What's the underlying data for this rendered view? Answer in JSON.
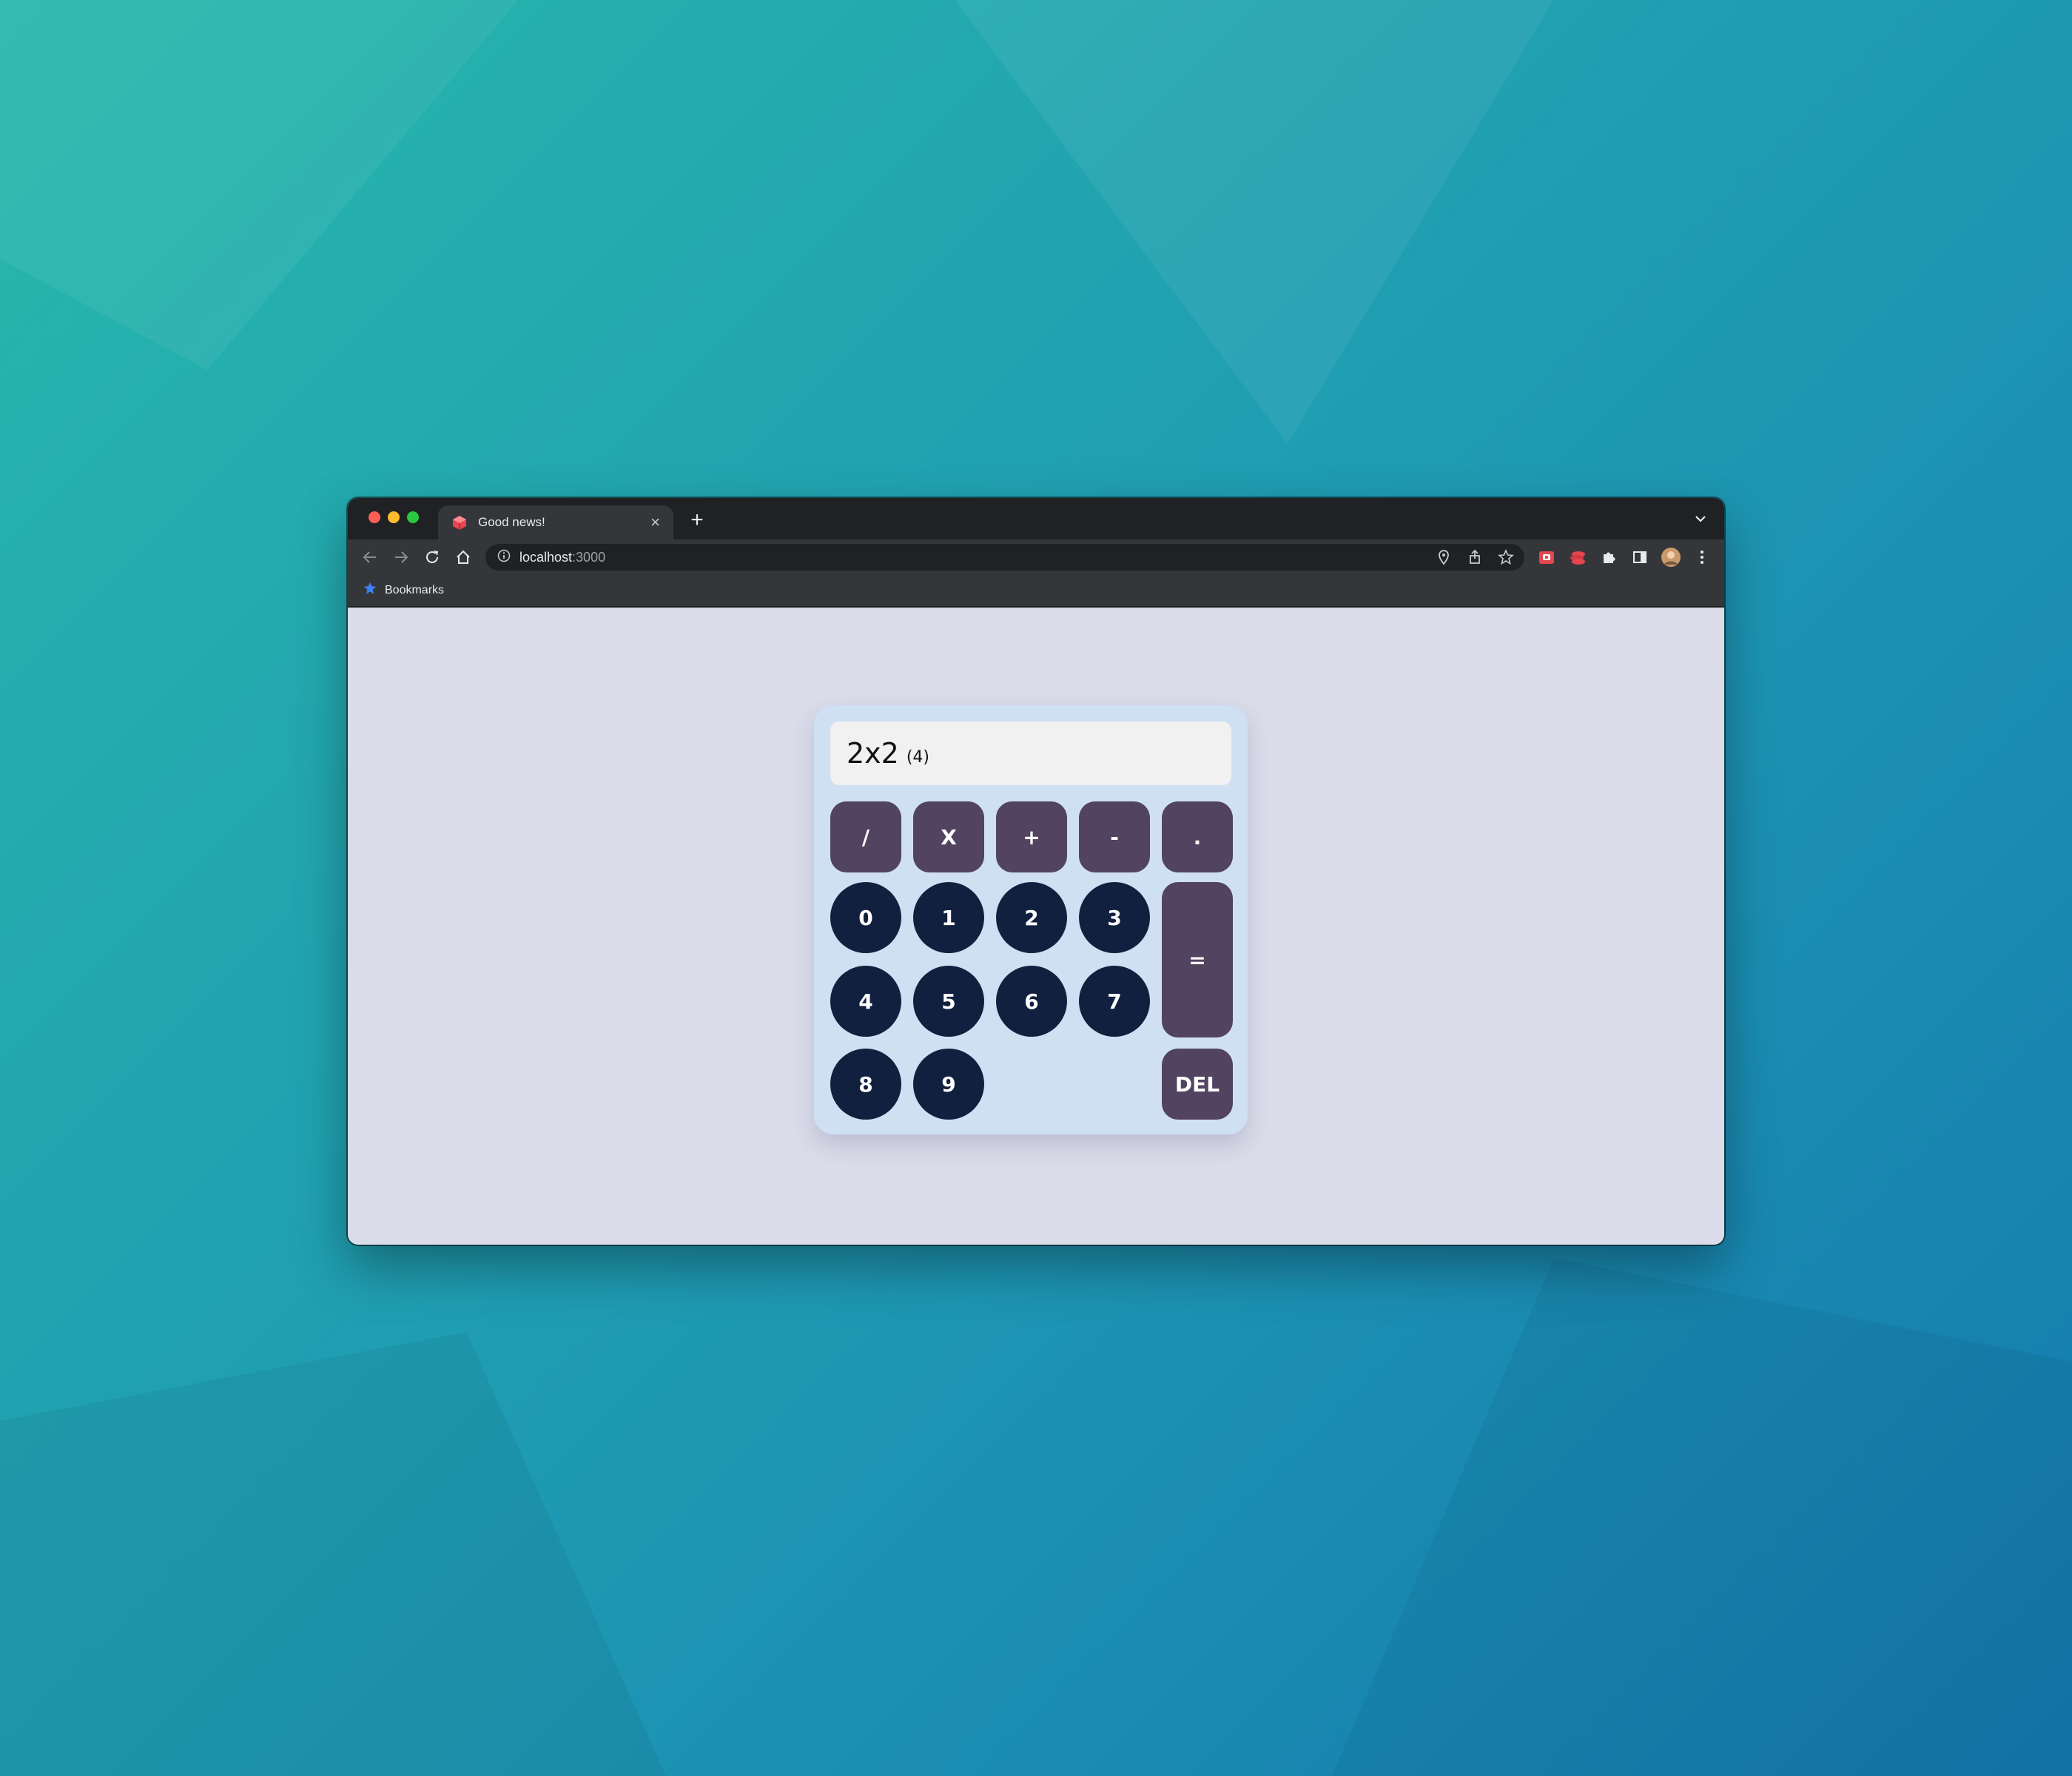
{
  "browser": {
    "tab": {
      "title": "Good news!",
      "favicon": "red-cube-icon",
      "close_label": "×"
    },
    "new_tab_label": "+",
    "address": {
      "host": "localhost",
      "port": ":3000"
    },
    "bookmarks_label": "Bookmarks",
    "colors": {
      "titlebar": "#202124",
      "toolbar": "#35363a",
      "page_bg": "#dadcea"
    }
  },
  "calculator": {
    "display": {
      "expression": "2x2",
      "result": "(4)"
    },
    "operators": [
      "/",
      "X",
      "+",
      "-",
      "."
    ],
    "digits": [
      "0",
      "1",
      "2",
      "3",
      "4",
      "5",
      "6",
      "7",
      "8",
      "9"
    ],
    "equals_label": "=",
    "delete_label": "DEL",
    "colors": {
      "operator": "#524461",
      "digit": "#11203f",
      "panel": "#cfe0f3",
      "display": "#f1f1f1"
    }
  }
}
